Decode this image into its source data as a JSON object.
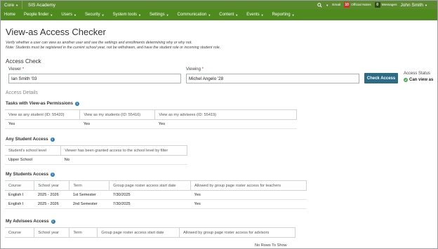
{
  "topbar": {
    "core_label": "Core",
    "academy": "SIS Academy",
    "email_label": "Email",
    "notes_count": "10",
    "notes_label": "Official Notes",
    "messages_count": "0",
    "messages_label": "Messages",
    "user_name": "John Smith"
  },
  "nav": {
    "items": [
      "Home",
      "People finder",
      "Users",
      "Security",
      "System tools",
      "Settings",
      "Communication",
      "Content",
      "Events",
      "Reporting"
    ]
  },
  "page": {
    "title": "View-as Access Checker",
    "desc_line1": "Verify whether a user can view as another user and see the settings and enrollments determining why or why not.",
    "desc_line2": "Note: Students must be registered in the current school year, not be withdrawn, and have the student role or incoming student role."
  },
  "access_check": {
    "heading": "Access Check",
    "viewer_label": "Viewer",
    "viewer_value": "Ian Smith '03",
    "viewing_label": "Viewing",
    "viewing_value": "Michel Angelo '28",
    "button_label": "Check Access",
    "status_label": "Access Status",
    "status_value": "Can view as",
    "required_mark": "*"
  },
  "details": {
    "heading": "Access Details",
    "tasks": {
      "title": "Tasks with View-as Permissions",
      "columns": [
        "View as any student (ID: 55420)",
        "View as my students (ID: 55416)",
        "View as my advisees (ID: 55419)"
      ],
      "rows": [
        [
          "Yes",
          "Yes",
          "Yes"
        ]
      ]
    },
    "any_student": {
      "title": "Any Student Access",
      "columns": [
        "Student's school level",
        "Viewer has been granted access to the school level by filter"
      ],
      "rows": [
        [
          "Upper School",
          "No"
        ]
      ]
    },
    "my_students": {
      "title": "My Students Access",
      "columns": [
        "Course",
        "School year",
        "Term",
        "Group page roster access start date",
        "Allowed by group page roster access for teachers"
      ],
      "rows": [
        [
          "English I",
          "2025 - 2026",
          "1st Semester",
          "7/30/2025",
          "Yes"
        ],
        [
          "English I",
          "2025 - 2026",
          "2nd Semester",
          "7/30/2025",
          "Yes"
        ]
      ]
    },
    "my_advisees": {
      "title": "My Advisees Access",
      "columns": [
        "Course",
        "School year",
        "Term",
        "Group page roster access start date",
        "Allowed by group page roster access for advisors"
      ],
      "empty_text": "No Rows To Show"
    }
  }
}
